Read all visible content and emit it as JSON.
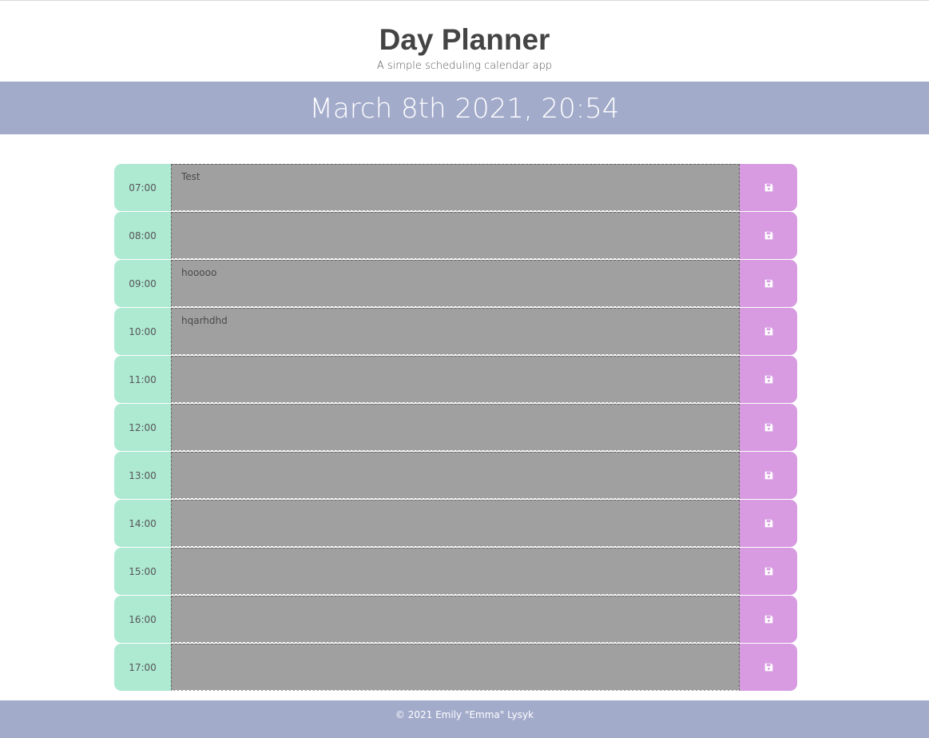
{
  "header": {
    "title": "Day Planner",
    "subtitle": "A simple scheduling calendar app"
  },
  "current_datetime": "March 8th 2021, 20:54",
  "rows": [
    {
      "hour": "07:00",
      "text": "Test",
      "save_icon": "save-icon"
    },
    {
      "hour": "08:00",
      "text": "",
      "save_icon": "save-icon"
    },
    {
      "hour": "09:00",
      "text": "hooooo",
      "save_icon": "save-icon"
    },
    {
      "hour": "10:00",
      "text": "hqarhdhd",
      "save_icon": "save-icon"
    },
    {
      "hour": "11:00",
      "text": "",
      "save_icon": "save-icon"
    },
    {
      "hour": "12:00",
      "text": "",
      "save_icon": "save-icon"
    },
    {
      "hour": "13:00",
      "text": "",
      "save_icon": "save-icon"
    },
    {
      "hour": "14:00",
      "text": "",
      "save_icon": "save-icon"
    },
    {
      "hour": "15:00",
      "text": "",
      "save_icon": "save-icon"
    },
    {
      "hour": "16:00",
      "text": "",
      "save_icon": "save-icon"
    },
    {
      "hour": "17:00",
      "text": "",
      "save_icon": "save-icon"
    }
  ],
  "footer": {
    "text": "© 2021 Emily \"Emma\" Lysyk"
  },
  "colors": {
    "banner": "#a3abcb",
    "hour_bg": "#aee9d2",
    "entry_past": "#a0a0a0",
    "save_bg": "#d89be2"
  }
}
